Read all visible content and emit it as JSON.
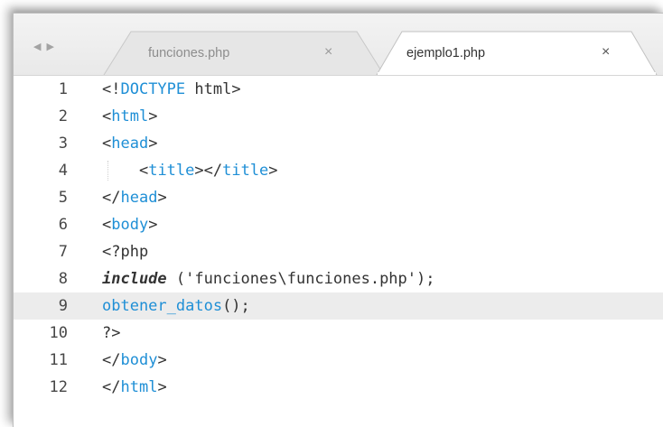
{
  "tabs": [
    {
      "title": "funciones.php",
      "close": "×",
      "active": false
    },
    {
      "title": "ejemplo1.php",
      "close": "×",
      "active": true
    }
  ],
  "nav": {
    "back": "◀",
    "forward": "▶"
  },
  "editor": {
    "current_line": 9,
    "lines": [
      {
        "num": "1",
        "tokens": [
          [
            "t-punct",
            "<!"
          ],
          [
            "t-tag",
            "DOCTYPE"
          ],
          [
            "t-plain",
            " html"
          ],
          [
            "t-punct",
            ">"
          ]
        ]
      },
      {
        "num": "2",
        "tokens": [
          [
            "t-punct",
            "<"
          ],
          [
            "t-tag",
            "html"
          ],
          [
            "t-punct",
            ">"
          ]
        ]
      },
      {
        "num": "3",
        "tokens": [
          [
            "t-punct",
            "<"
          ],
          [
            "t-tag",
            "head"
          ],
          [
            "t-punct",
            ">"
          ]
        ]
      },
      {
        "num": "4",
        "tokens": [
          [
            "t-plain",
            "    "
          ],
          [
            "t-punct",
            "<"
          ],
          [
            "t-tag",
            "title"
          ],
          [
            "t-punct",
            "></"
          ],
          [
            "t-tag",
            "title"
          ],
          [
            "t-punct",
            ">"
          ]
        ]
      },
      {
        "num": "5",
        "tokens": [
          [
            "t-punct",
            "</"
          ],
          [
            "t-tag",
            "head"
          ],
          [
            "t-punct",
            ">"
          ]
        ]
      },
      {
        "num": "6",
        "tokens": [
          [
            "t-punct",
            "<"
          ],
          [
            "t-tag",
            "body"
          ],
          [
            "t-punct",
            ">"
          ]
        ]
      },
      {
        "num": "7",
        "tokens": [
          [
            "t-punct",
            "<?"
          ],
          [
            "t-plain",
            "php"
          ]
        ]
      },
      {
        "num": "8",
        "tokens": [
          [
            "t-kw",
            "include"
          ],
          [
            "t-plain",
            " ("
          ],
          [
            "t-str",
            "'funciones\\funciones.php'"
          ],
          [
            "t-plain",
            ");"
          ]
        ]
      },
      {
        "num": "9",
        "tokens": [
          [
            "t-fn",
            "obtener_datos"
          ],
          [
            "t-plain",
            "();"
          ]
        ]
      },
      {
        "num": "10",
        "tokens": [
          [
            "t-punct",
            "?>"
          ]
        ]
      },
      {
        "num": "11",
        "tokens": [
          [
            "t-punct",
            "</"
          ],
          [
            "t-tag",
            "body"
          ],
          [
            "t-punct",
            ">"
          ]
        ]
      },
      {
        "num": "12",
        "tokens": [
          [
            "t-punct",
            "</"
          ],
          [
            "t-tag",
            "html"
          ],
          [
            "t-punct",
            ">"
          ]
        ]
      }
    ]
  }
}
